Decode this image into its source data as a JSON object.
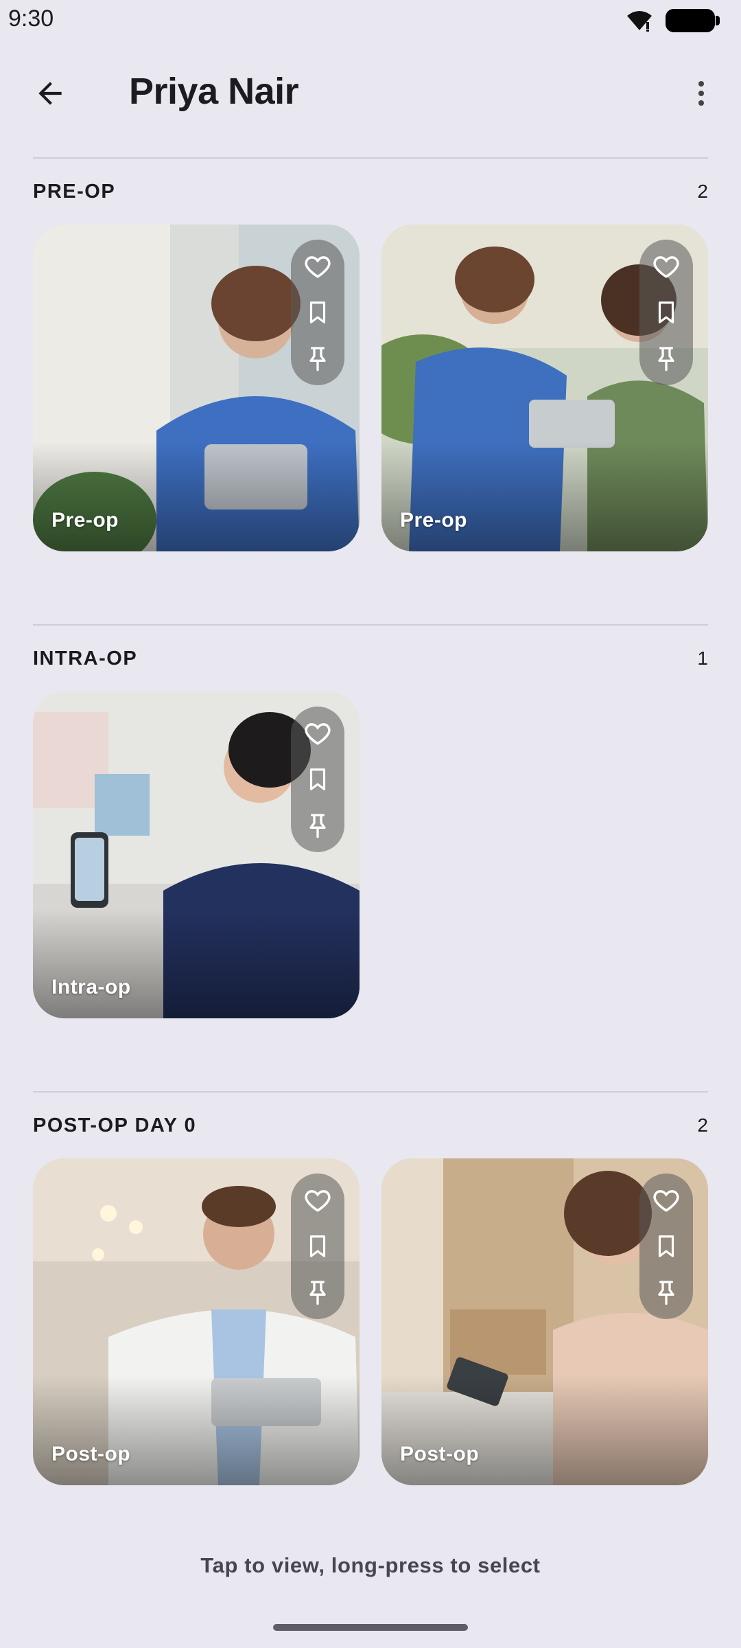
{
  "status_bar": {
    "time": "9:30",
    "wifi_icon": "wifi-icon",
    "battery_icon": "battery-icon"
  },
  "app_bar": {
    "title": "Priya Nair",
    "back_icon": "arrow-back-icon",
    "more_icon": "more-vert-icon"
  },
  "sections": [
    {
      "title": "PRE-OP",
      "count": "2",
      "cards": [
        {
          "label": "Pre-op"
        },
        {
          "label": "Pre-op"
        }
      ]
    },
    {
      "title": "INTRA-OP",
      "count": "1",
      "cards": [
        {
          "label": "Intra-op"
        }
      ]
    },
    {
      "title": "POST-OP DAY 0",
      "count": "2",
      "cards": [
        {
          "label": "Post-op"
        },
        {
          "label": "Post-op"
        }
      ]
    }
  ],
  "card_actions": [
    "heart-icon",
    "bookmark-icon",
    "pin-icon"
  ],
  "footer": {
    "hint": "Tap to view, long-press to select"
  },
  "colors": {
    "background": "#E9E7EF",
    "divider": "#CFCDD6",
    "text": "#1C1B1F",
    "hint_text": "#47454E"
  }
}
